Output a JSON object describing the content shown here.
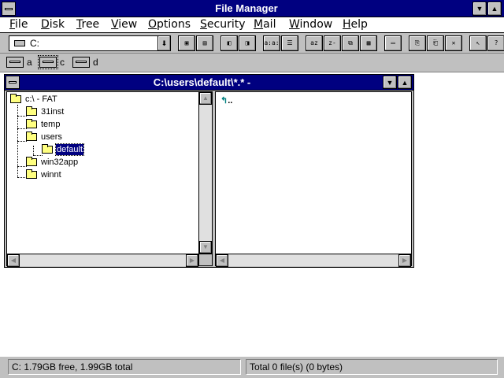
{
  "app": {
    "title": "File Manager"
  },
  "menu": [
    "File",
    "Disk",
    "Tree",
    "View",
    "Options",
    "Security",
    "Mail",
    "Window",
    "Help"
  ],
  "toolbar": {
    "drive_combo_value": "C:",
    "buttons": [
      "connect-drive",
      "disconnect-drive",
      "share",
      "stop-sharing",
      "large-icons",
      "list-view",
      "sort-name",
      "sort-type",
      "sort-size",
      "sort-date",
      "new-window",
      "copy",
      "move",
      "delete",
      "properties",
      "help"
    ]
  },
  "drives": [
    {
      "letter": "a",
      "selected": false
    },
    {
      "letter": "c",
      "selected": true
    },
    {
      "letter": "d",
      "selected": false
    }
  ],
  "child_window": {
    "title": "C:\\users\\default\\*.* -",
    "tree": [
      {
        "label": "c:\\ - FAT",
        "level": 0
      },
      {
        "label": "31inst",
        "level": 1
      },
      {
        "label": "temp",
        "level": 1
      },
      {
        "label": "users",
        "level": 1
      },
      {
        "label": "default",
        "level": 2,
        "selected": true,
        "open": true
      },
      {
        "label": "win32app",
        "level": 1
      },
      {
        "label": "winnt",
        "level": 1
      }
    ],
    "contents": [
      {
        "label": "..",
        "icon": "up-arrow-icon"
      }
    ]
  },
  "status": {
    "left": "C: 1.79GB free,  1.99GB total",
    "right": "Total 0 file(s) (0 bytes)"
  }
}
